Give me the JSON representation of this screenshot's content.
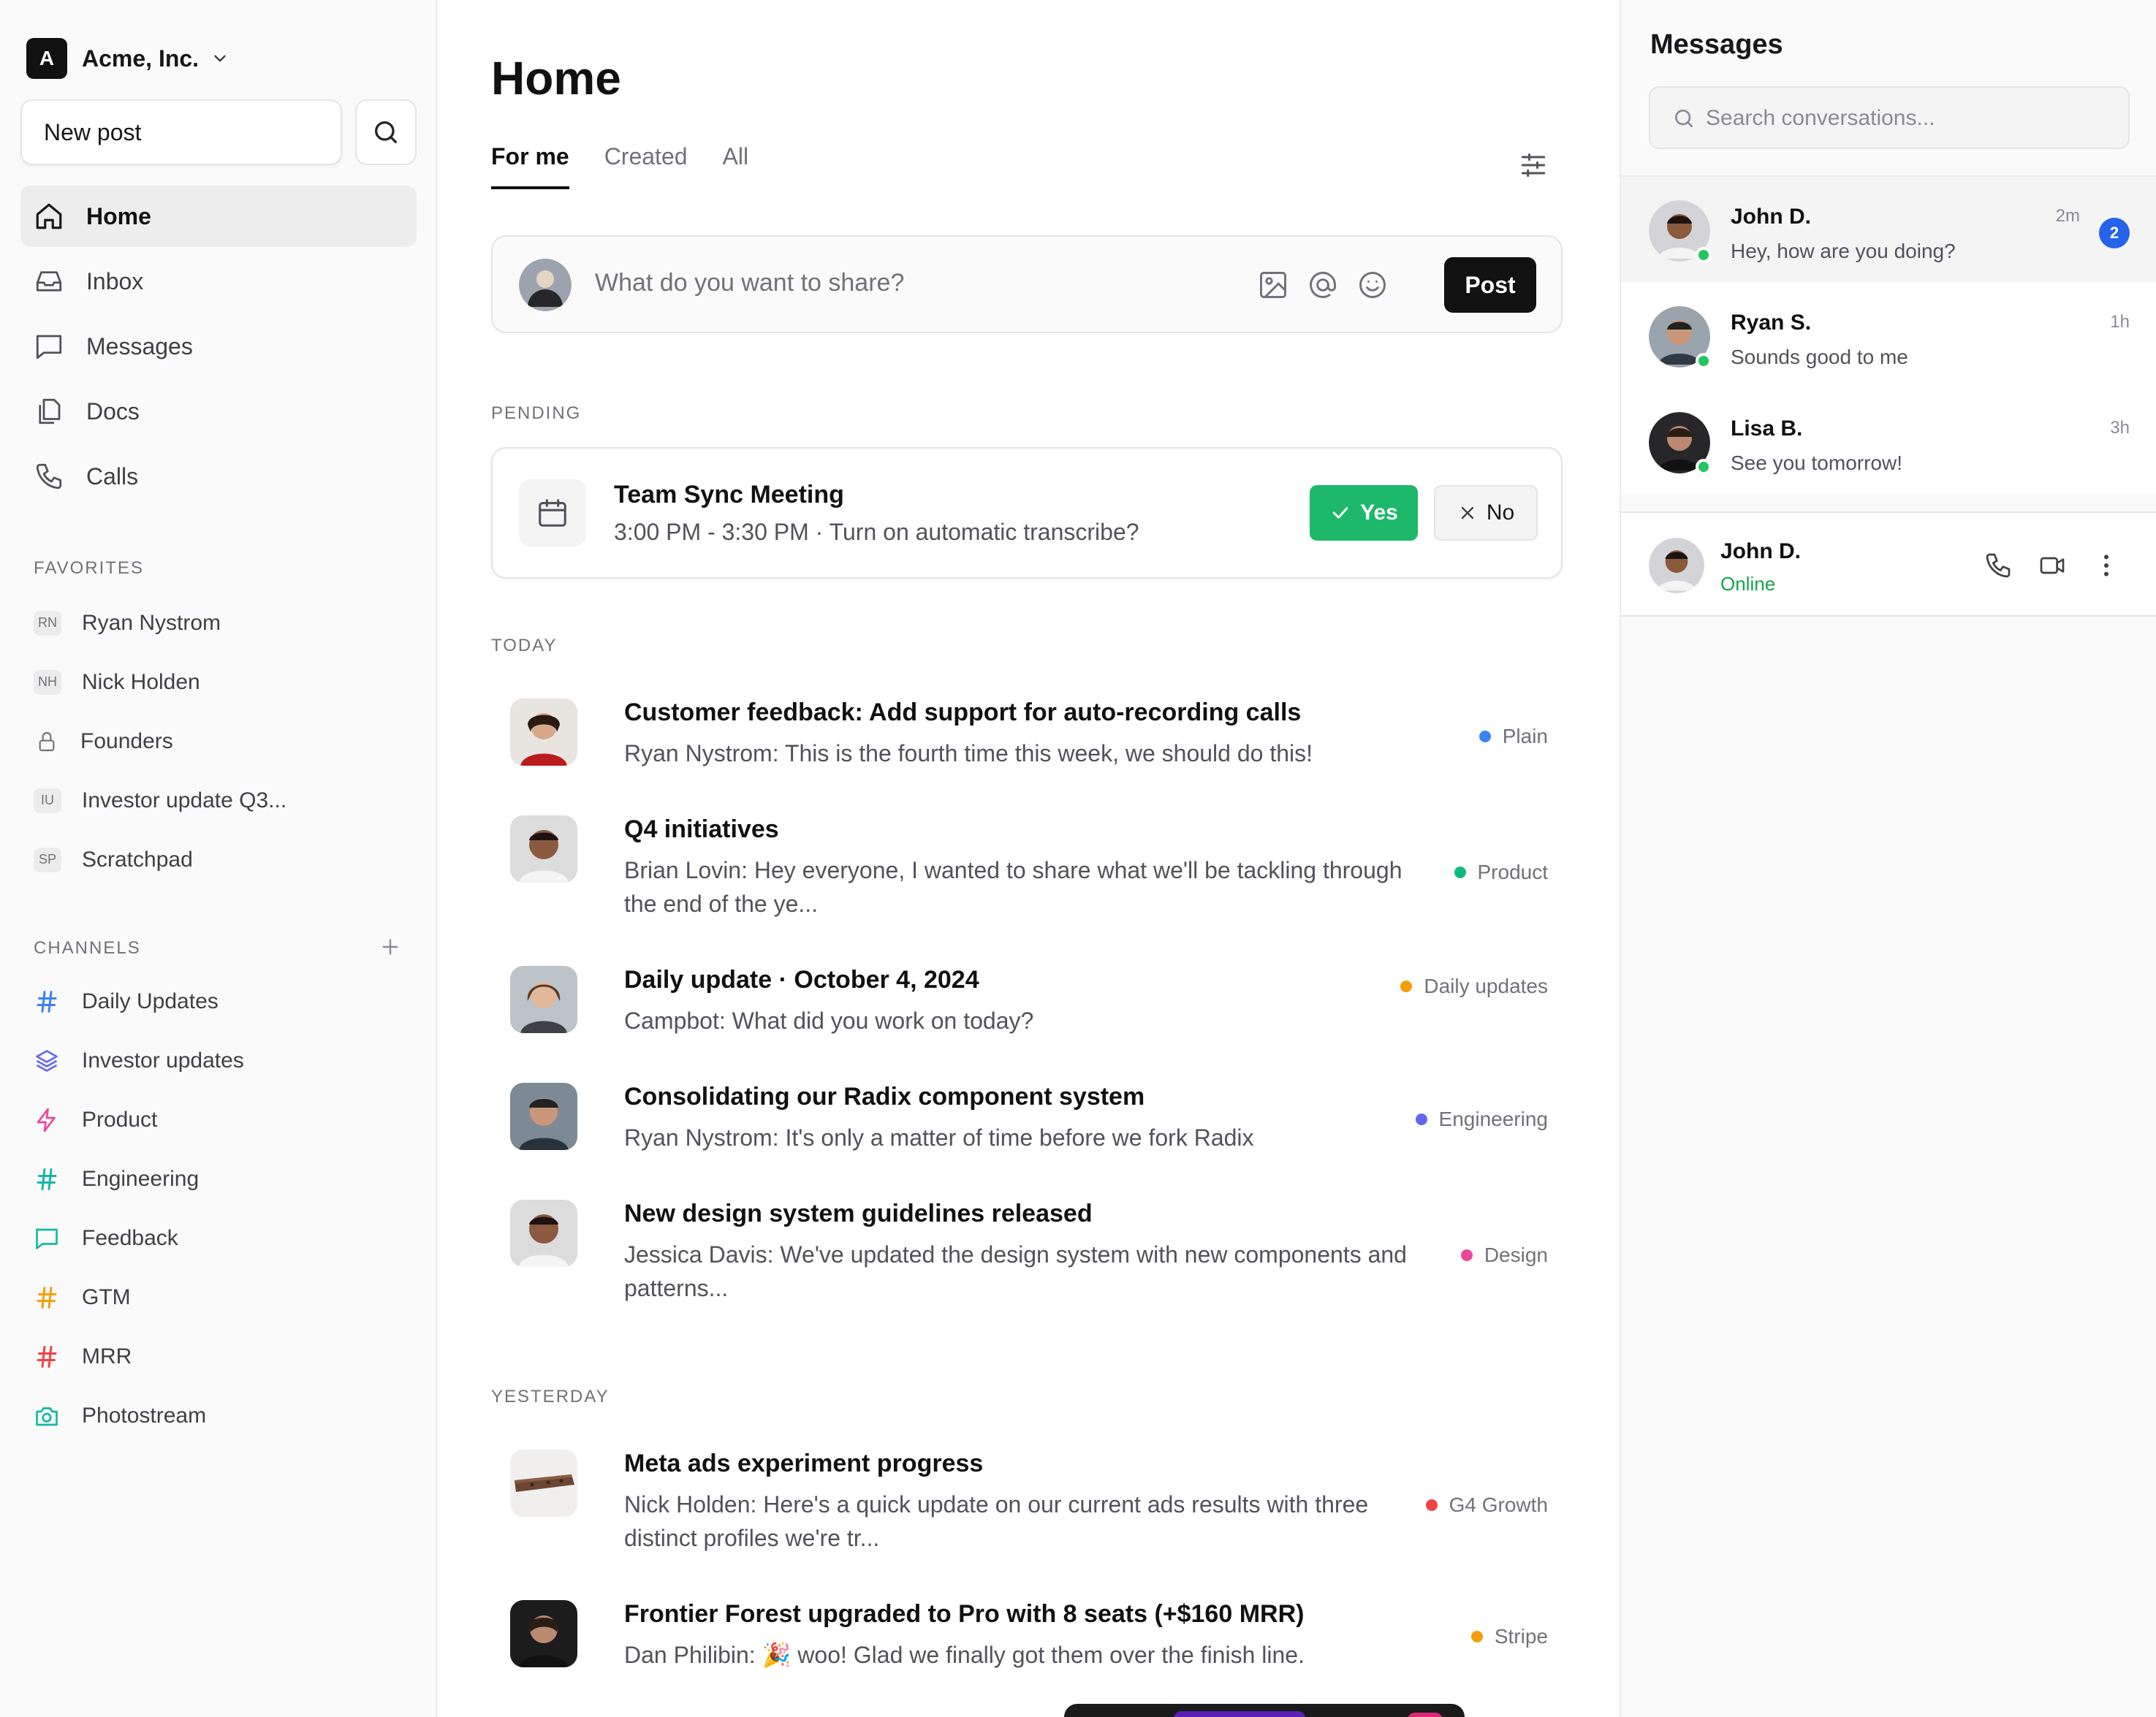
{
  "org": {
    "initial": "A",
    "name": "Acme, Inc."
  },
  "sidebar": {
    "new_post_label": "New post",
    "nav": [
      {
        "label": "Home",
        "icon": "home-icon"
      },
      {
        "label": "Inbox",
        "icon": "inbox-icon"
      },
      {
        "label": "Messages",
        "icon": "message-icon"
      },
      {
        "label": "Docs",
        "icon": "docs-icon"
      },
      {
        "label": "Calls",
        "icon": "phone-icon"
      }
    ],
    "favorites_label": "FAVORITES",
    "favorites": [
      {
        "badge": "RN",
        "label": "Ryan Nystrom"
      },
      {
        "badge": "NH",
        "label": "Nick Holden"
      },
      {
        "icon": "lock-icon",
        "label": "Founders"
      },
      {
        "badge": "IU",
        "label": "Investor update Q3..."
      },
      {
        "badge": "SP",
        "label": "Scratchpad"
      }
    ],
    "channels_label": "CHANNELS",
    "channels": [
      {
        "label": "Daily Updates",
        "icon": "hash-icon",
        "color": "#3b82f6"
      },
      {
        "label": "Investor updates",
        "icon": "layers-icon",
        "color": "#6366f1"
      },
      {
        "label": "Product",
        "icon": "bolt-icon",
        "color": "#ec4899"
      },
      {
        "label": "Engineering",
        "icon": "hash-icon",
        "color": "#14b8a6"
      },
      {
        "label": "Feedback",
        "icon": "chat-icon",
        "color": "#14b8a6"
      },
      {
        "label": "GTM",
        "icon": "hash-icon",
        "color": "#f59e0b"
      },
      {
        "label": "MRR",
        "icon": "hash-icon",
        "color": "#ef4444"
      },
      {
        "label": "Photostream",
        "icon": "camera-icon",
        "color": "#14b8a6"
      }
    ]
  },
  "main": {
    "title": "Home",
    "tabs": [
      "For me",
      "Created",
      "All"
    ],
    "composer": {
      "placeholder": "What do you want to share?",
      "post_label": "Post"
    },
    "pending_label": "PENDING",
    "pending": {
      "title": "Team Sync Meeting",
      "subtitle": "3:00 PM - 3:30 PM · Turn on automatic transcribe?",
      "yes_label": "Yes",
      "no_label": "No"
    },
    "today_label": "TODAY",
    "yesterday_label": "YESTERDAY",
    "feed": [
      {
        "title": "Customer feedback: Add support for auto-recording calls",
        "body": "Ryan Nystrom: This is the fourth time this week, we should do this!",
        "tag": "Plain",
        "tag_color": "#3b82f6"
      },
      {
        "title": "Q4 initiatives",
        "body": "Brian Lovin: Hey everyone, I wanted to share what we'll be tackling through the end of the ye...",
        "tag": "Product",
        "tag_color": "#10b981"
      },
      {
        "title": "Daily update · October 4, 2024",
        "body": "Campbot: What did you work on today?",
        "tag": "Daily updates",
        "tag_color": "#f59e0b"
      },
      {
        "title": "Consolidating our Radix component system",
        "body": "Ryan Nystrom: It's only a matter of time before we fork Radix",
        "tag": "Engineering",
        "tag_color": "#6366f1"
      },
      {
        "title": "New design system guidelines released",
        "body": "Jessica Davis: We've updated the design system with new components and patterns...",
        "tag": "Design",
        "tag_color": "#ec4899"
      },
      {
        "title": "Meta ads experiment progress",
        "body": "Nick Holden: Here's a quick update on our current ads results with three distinct profiles we're tr...",
        "tag": "G4 Growth",
        "tag_color": "#ef4444"
      },
      {
        "title": "Frontier Forest upgraded to Pro with 8 seats (+$160 MRR)",
        "body": "Dan Philibin: 🎉 woo! Glad we finally got them over the finish line.",
        "tag": "Stripe",
        "tag_color": "#f59e0b"
      }
    ]
  },
  "messages": {
    "title": "Messages",
    "search_placeholder": "Search conversations...",
    "conversations": [
      {
        "name": "John D.",
        "preview": "Hey, how are you doing?",
        "time": "2m",
        "unread": "2"
      },
      {
        "name": "Ryan S.",
        "preview": "Sounds good to me",
        "time": "1h"
      },
      {
        "name": "Lisa B.",
        "preview": "See you tomorrow!",
        "time": "3h"
      }
    ],
    "active_contact": {
      "name": "John D.",
      "status": "Online"
    }
  }
}
